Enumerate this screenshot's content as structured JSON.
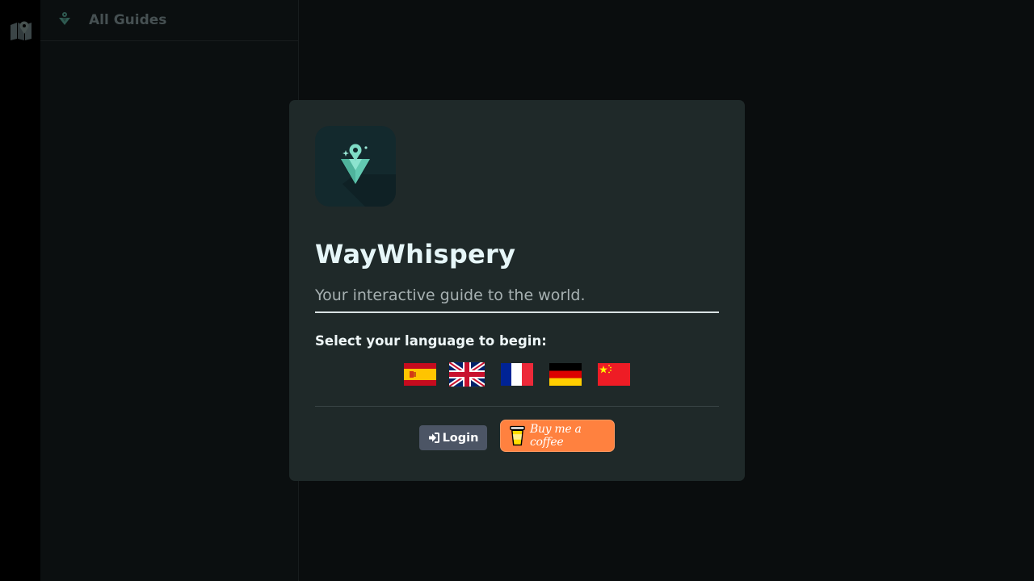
{
  "sidebar": {
    "title": "All Guides"
  },
  "modal": {
    "app_name": "WayWhispery",
    "tagline": "Your interactive guide to the world.",
    "language_prompt": "Select your language to begin:",
    "languages": [
      {
        "code": "es",
        "icon": "spain-flag-icon",
        "selected": false
      },
      {
        "code": "en",
        "icon": "uk-flag-icon",
        "selected": true
      },
      {
        "code": "fr",
        "icon": "france-flag-icon",
        "selected": false
      },
      {
        "code": "de",
        "icon": "germany-flag-icon",
        "selected": false
      },
      {
        "code": "zh",
        "icon": "china-flag-icon",
        "selected": false
      }
    ],
    "login_label": "Login",
    "coffee_label": "Buy me a coffee"
  },
  "colors": {
    "background": "#0a0d0e",
    "modal_bg": "#1f2929",
    "accent_teal": "#5ac8b0",
    "login_bg": "#4c5565",
    "coffee_bg": "#ff813f"
  }
}
